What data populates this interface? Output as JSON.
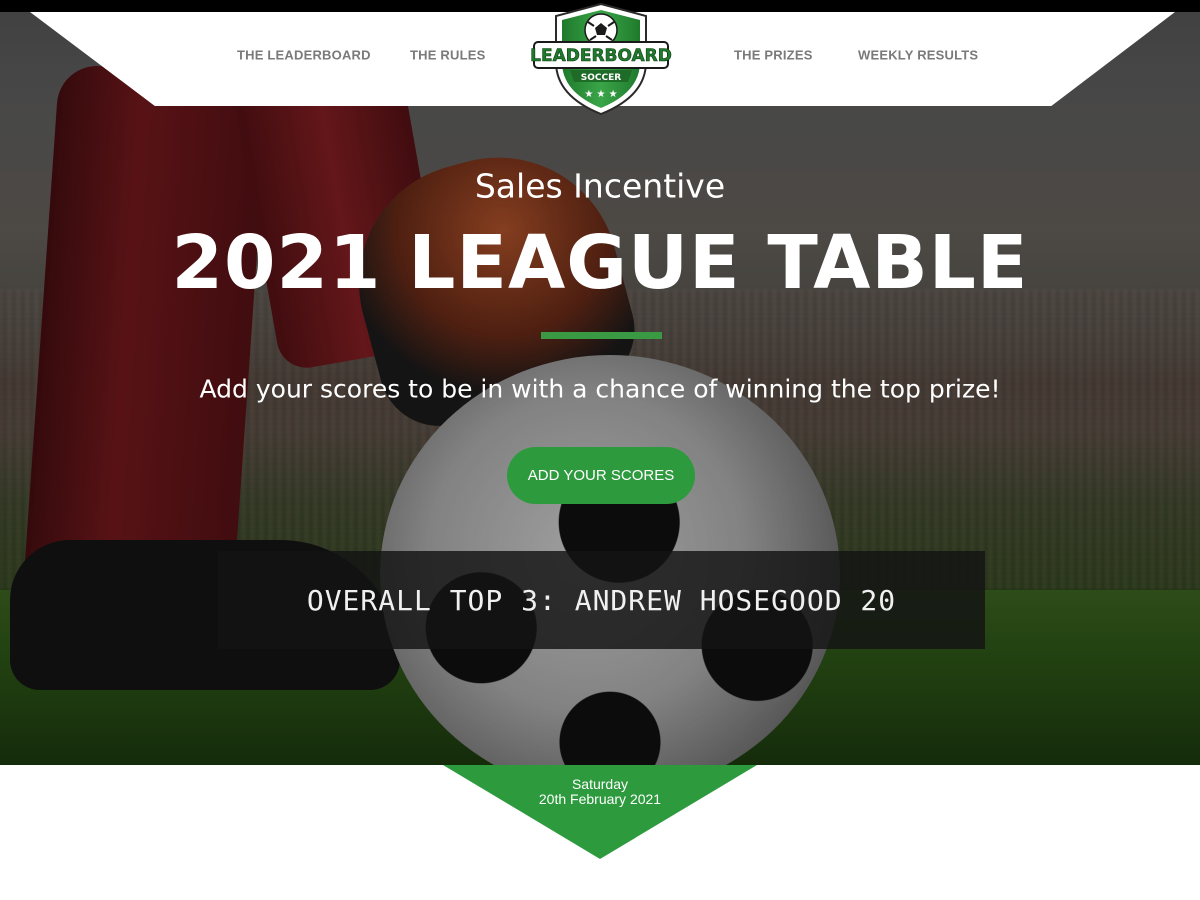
{
  "nav": {
    "links": [
      "THE LEADERBOARD",
      "THE RULES",
      "THE PRIZES",
      "WEEKLY RESULTS"
    ]
  },
  "logo": {
    "text_main": "LEADERBOARD",
    "text_sub": "SOCCER"
  },
  "hero": {
    "subtitle": "Sales Incentive",
    "title": "2021 LEAGUE TABLE",
    "tagline": "Add your scores to be in with a chance of winning the top prize!",
    "cta_label": "ADD YOUR SCORES",
    "ticker": "OVERALL TOP 3: ANDREW HOSEGOOD 20"
  },
  "date": {
    "day": "Saturday",
    "full": "20th February 2021"
  },
  "colors": {
    "accent_green": "#2e9a3e",
    "nav_text": "#7a7a7a",
    "white": "#ffffff"
  },
  "icons": [
    "soccer-ball-icon",
    "leaderboard-shield-logo"
  ]
}
